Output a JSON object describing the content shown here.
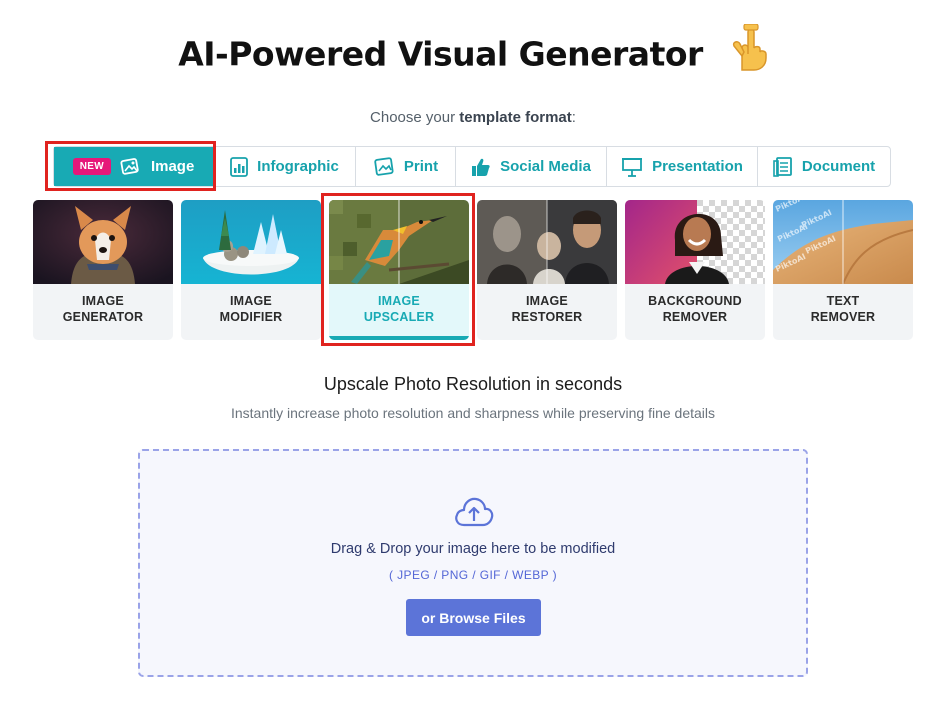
{
  "header": {
    "title": "AI-Powered Visual Generator",
    "title_emoji": "pointing-down-hand",
    "subtitle_prefix": "Choose your ",
    "subtitle_bold": "template format",
    "subtitle_suffix": ":"
  },
  "tabs": [
    {
      "label": "Image",
      "badge": "NEW",
      "icon": "image-icon",
      "active": true
    },
    {
      "label": "Infographic",
      "icon": "bar-chart-icon",
      "active": false
    },
    {
      "label": "Print",
      "icon": "print-image-icon",
      "active": false
    },
    {
      "label": "Social Media",
      "icon": "thumbs-up-icon",
      "active": false
    },
    {
      "label": "Presentation",
      "icon": "presentation-icon",
      "active": false
    },
    {
      "label": "Document",
      "icon": "document-icon",
      "active": false
    }
  ],
  "tools": [
    {
      "line1": "IMAGE",
      "line2": "GENERATOR",
      "selected": false
    },
    {
      "line1": "IMAGE",
      "line2": "MODIFIER",
      "selected": false
    },
    {
      "line1": "IMAGE",
      "line2": "UPSCALER",
      "selected": true
    },
    {
      "line1": "IMAGE",
      "line2": "RESTORER",
      "selected": false
    },
    {
      "line1": "BACKGROUND",
      "line2": "REMOVER",
      "selected": false
    },
    {
      "line1": "TEXT",
      "line2": "REMOVER",
      "selected": false
    }
  ],
  "section": {
    "title": "Upscale Photo Resolution in seconds",
    "description": "Instantly increase photo resolution and sharpness while preserving fine details"
  },
  "upload": {
    "prompt": "Drag & Drop your image here to be modified",
    "formats": "( JPEG / PNG / GIF / WEBP )",
    "browse_label": "or Browse Files",
    "icon": "cloud-upload-icon"
  },
  "watermark_text": "PiktoAI",
  "colors": {
    "accent": "#18aab4",
    "badge": "#e6177a",
    "button": "#5c74d8",
    "highlight": "#e0231f"
  }
}
